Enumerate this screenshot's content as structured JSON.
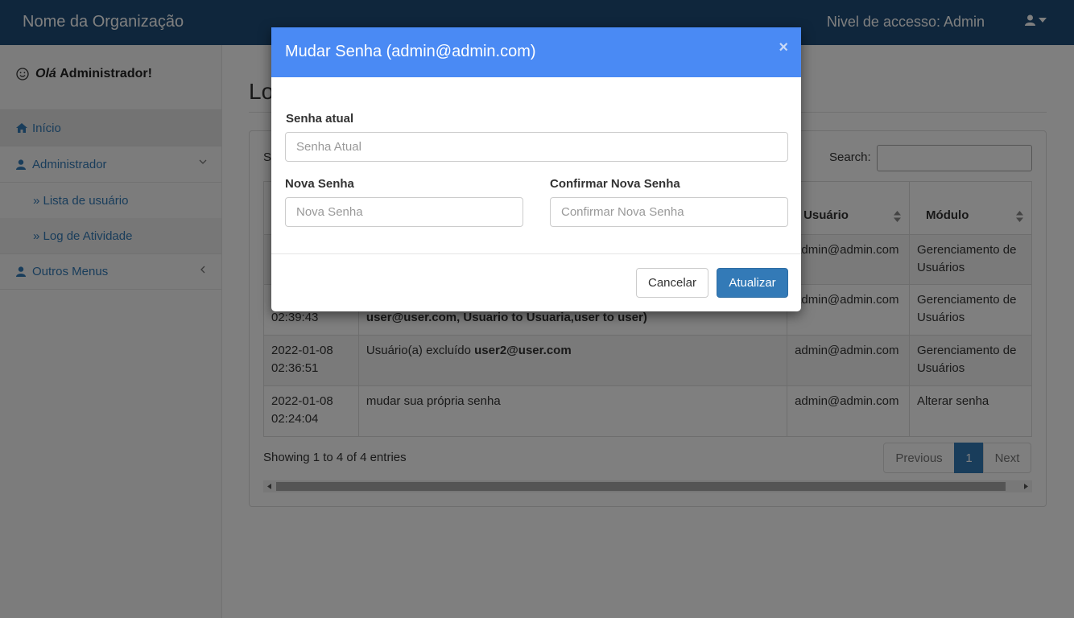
{
  "navbar": {
    "brand": "Nome da Organização",
    "access_level": "Nivel de accesso: Admin"
  },
  "sidebar": {
    "greeting_prefix": "Olá",
    "greeting_name": "Administrador!",
    "items": [
      {
        "label": "Início"
      },
      {
        "label": "Administrador"
      },
      {
        "label": "» Lista de usuário"
      },
      {
        "label": "» Log de Atividade"
      },
      {
        "label": "Outros Menus"
      }
    ]
  },
  "main": {
    "title": "Lo",
    "show_label": "S",
    "search_label": "Search:",
    "table": {
      "headers": [
        "",
        "",
        "Usuário",
        "Módulo"
      ],
      "rows": [
        {
          "date": "",
          "time": "",
          "desc": "",
          "desc_bold": "",
          "user": "admin@admin.com",
          "module": "Gerenciamento de Usuários"
        },
        {
          "date": "",
          "time": "02:39:43",
          "desc": "",
          "desc_bold": "user@user.com, Usuario to Usuaria,user to user)",
          "user": "admin@admin.com",
          "module": "Gerenciamento de Usuários"
        },
        {
          "date": "2022-01-08",
          "time": "02:36:51",
          "desc": "Usuário(a) excluído ",
          "desc_bold": "user2@user.com",
          "user": "admin@admin.com",
          "module": "Gerenciamento de Usuários"
        },
        {
          "date": "2022-01-08",
          "time": "02:24:04",
          "desc": "mudar sua própria senha",
          "desc_bold": "",
          "user": "admin@admin.com",
          "module": "Alterar senha"
        }
      ]
    },
    "info": "Showing 1 to 4 of 4 entries",
    "pager": {
      "prev": "Previous",
      "current": "1",
      "next": "Next"
    }
  },
  "modal": {
    "title": "Mudar Senha (admin@admin.com)",
    "close": "×",
    "current_label": "Senha atual",
    "current_placeholder": "Senha Atual",
    "new_label": "Nova Senha",
    "new_placeholder": "Nova Senha",
    "confirm_label": "Confirmar Nova Senha",
    "confirm_placeholder": "Confirmar Nova Senha",
    "cancel": "Cancelar",
    "update": "Atualizar"
  },
  "colors": {
    "navbar": "#1e4d78",
    "modal_header": "#4a8af4",
    "primary": "#337ab7"
  }
}
